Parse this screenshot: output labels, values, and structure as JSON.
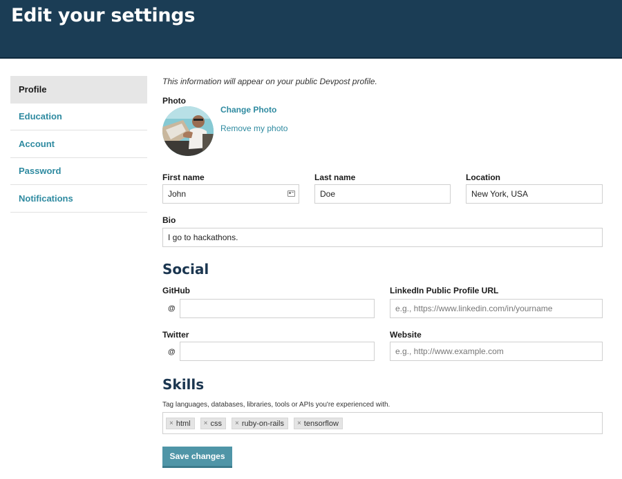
{
  "header": {
    "title": "Edit your settings"
  },
  "sidebar": {
    "items": [
      {
        "label": "Profile",
        "active": true
      },
      {
        "label": "Education"
      },
      {
        "label": "Account"
      },
      {
        "label": "Password"
      },
      {
        "label": "Notifications"
      }
    ]
  },
  "profile": {
    "intro": "This information will appear on your public Devpost profile.",
    "photo_label": "Photo",
    "change_photo": "Change Photo",
    "remove_photo": "Remove my photo",
    "first_name_label": "First name",
    "first_name_value": "John",
    "last_name_label": "Last name",
    "last_name_value": "Doe",
    "location_label": "Location",
    "location_value": "New York, USA",
    "bio_label": "Bio",
    "bio_value": "I go to hackathons."
  },
  "social": {
    "heading": "Social",
    "github_label": "GitHub",
    "github_prefix": "@",
    "github_value": "",
    "linkedin_label": "LinkedIn Public Profile URL",
    "linkedin_placeholder": "e.g., https://www.linkedin.com/in/yourname",
    "twitter_label": "Twitter",
    "twitter_prefix": "@",
    "twitter_value": "",
    "website_label": "Website",
    "website_placeholder": "e.g., http://www.example.com"
  },
  "skills": {
    "heading": "Skills",
    "hint": "Tag languages, databases, libraries, tools or APIs you're experienced with.",
    "remove_glyph": "×",
    "tags": [
      "html",
      "css",
      "ruby-on-rails",
      "tensorflow"
    ]
  },
  "actions": {
    "save_label": "Save changes"
  },
  "colors": {
    "header_bg": "#1b3d55",
    "link": "#2e8aa0",
    "button_bg": "#4f95a7",
    "section_heading": "#1b3650"
  },
  "icons": {
    "first_name_field_icon": "contact-card-icon",
    "tag_remove_icon": "close-icon"
  }
}
